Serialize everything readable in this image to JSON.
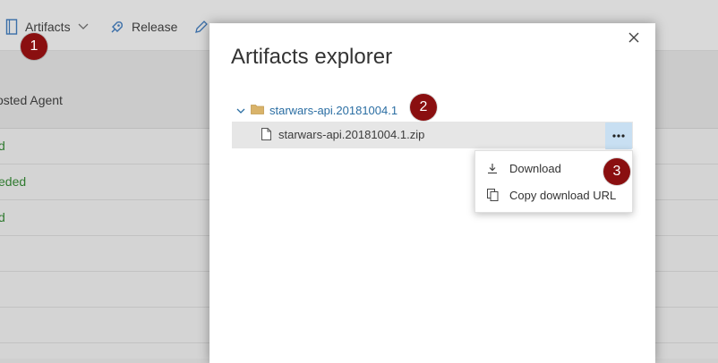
{
  "toolbar": {
    "artifacts_label": "Artifacts",
    "release_label": "Release"
  },
  "background_table": {
    "header_partial": "osted Agent",
    "rows": [
      {
        "status_partial": "d"
      },
      {
        "status_partial": "eded"
      },
      {
        "status_partial": "d"
      }
    ]
  },
  "modal": {
    "title": "Artifacts explorer",
    "folder_name": "starwars-api.20181004.1",
    "file_name": "starwars-api.20181004.1.zip",
    "context_menu": {
      "download": "Download",
      "copy_url": "Copy download URL"
    }
  },
  "annotations": [
    "1",
    "2",
    "3"
  ],
  "colors": {
    "accent_link": "#2b6ea3",
    "badge": "#8a0f10",
    "success_text": "#2f7a2f",
    "more_button_bg": "#c8dff2",
    "folder_icon": "#d9b36a"
  },
  "icons": [
    "artifacts-icon",
    "chevron-down-icon",
    "rocket-icon",
    "pencil-icon",
    "close-icon",
    "folder-icon",
    "file-icon",
    "ellipsis-icon",
    "download-icon",
    "copy-icon"
  ]
}
